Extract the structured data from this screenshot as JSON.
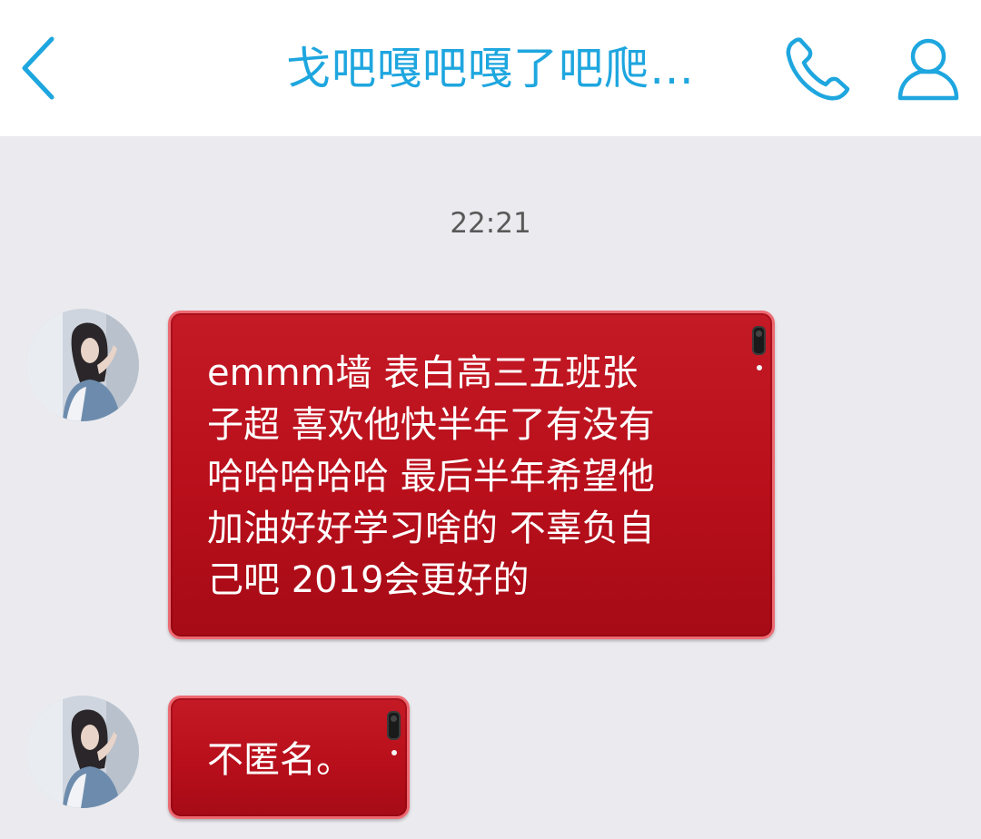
{
  "header": {
    "title": "戈吧嘎吧嘎了吧爬…",
    "back_icon": "chevron-left-icon",
    "call_icon": "phone-icon",
    "profile_icon": "user-icon",
    "accent_color": "#1ea6df"
  },
  "chat": {
    "timestamp": "22:21",
    "bubble_color": "#b8101c",
    "messages": [
      {
        "sender": "contact",
        "text": "emmm墙 表白高三五班张\n子超 喜欢他快半年了有没有\n哈哈哈哈哈 最后半年希望他\n加油好好学习啥的 不辜负自\n己吧 2019会更好的"
      },
      {
        "sender": "contact",
        "text": "不匿名。"
      }
    ]
  }
}
